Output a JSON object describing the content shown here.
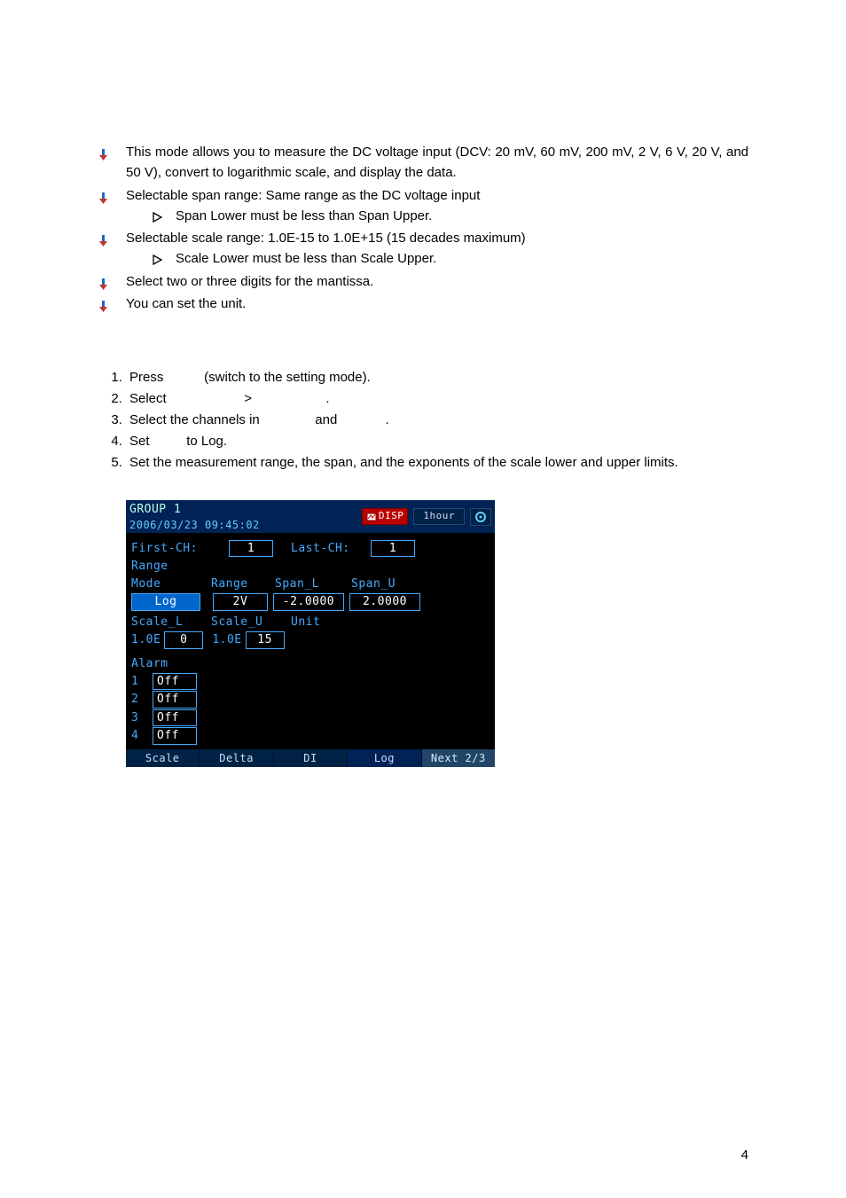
{
  "bullets": [
    {
      "text": "This mode allows you to measure the DC voltage input (DCV: 20 mV, 60 mV, 200 mV, 2 V, 6 V, 20 V, and 50 V), convert to logarithmic scale, and display the data."
    },
    {
      "text": "Selectable span range:  Same range as the DC voltage input",
      "sub": [
        "Span Lower must be less than Span Upper."
      ]
    },
    {
      "text": "Selectable scale range:  1.0E-15 to 1.0E+15 (15 decades maximum)",
      "sub": [
        "Scale Lower must be less than Scale Upper."
      ]
    },
    {
      "text": "Select two or three digits for the mantissa."
    },
    {
      "text": "You can set the unit."
    }
  ],
  "steps": [
    "Press           (switch to the setting mode).",
    "Select                     >                    .",
    "Select the channels in               and             .",
    "Set          to Log.",
    "Set the measurement range, the span, and the exponents of the scale lower and upper limits."
  ],
  "screenshot": {
    "header": {
      "group": "GROUP 1",
      "timestamp": "2006/03/23 09:45:02",
      "disp": "DISP",
      "period": "1hour"
    },
    "first_ch_label": "First-CH:",
    "first_ch_value": "1",
    "last_ch_label": "Last-CH:",
    "last_ch_value": "1",
    "range_heading": "Range",
    "mode_label": "Mode",
    "range_col": "Range",
    "spanl_col": "Span_L",
    "spanu_col": "Span_U",
    "mode_value": "Log",
    "range_value": "2V",
    "spanl_value": "-2.0000",
    "spanu_value": "2.0000",
    "scalel_label": "Scale_L",
    "scaleu_label": "Scale_U",
    "unit_label": "Unit",
    "scalel_prefix": "1.0E",
    "scalel_exp": "0",
    "scaleu_prefix": "1.0E",
    "scaleu_exp": "15",
    "alarm_heading": "Alarm",
    "alarms": [
      {
        "n": "1",
        "v": "Off"
      },
      {
        "n": "2",
        "v": "Off"
      },
      {
        "n": "3",
        "v": "Off"
      },
      {
        "n": "4",
        "v": "Off"
      }
    ],
    "tabs": [
      "Scale",
      "Delta",
      "DI",
      "Log",
      "Next 2/3"
    ]
  },
  "page_number": "4",
  "chart_data": {
    "type": "table",
    "title": "Range configuration (Log mode) screenshot values",
    "rows": [
      {
        "field": "First-CH",
        "value": 1
      },
      {
        "field": "Last-CH",
        "value": 1
      },
      {
        "field": "Mode",
        "value": "Log"
      },
      {
        "field": "Range",
        "value": "2V"
      },
      {
        "field": "Span_L",
        "value": -2.0
      },
      {
        "field": "Span_U",
        "value": 2.0
      },
      {
        "field": "Scale_L",
        "value": "1.0E0"
      },
      {
        "field": "Scale_U",
        "value": "1.0E15"
      },
      {
        "field": "Alarm 1",
        "value": "Off"
      },
      {
        "field": "Alarm 2",
        "value": "Off"
      },
      {
        "field": "Alarm 3",
        "value": "Off"
      },
      {
        "field": "Alarm 4",
        "value": "Off"
      }
    ]
  }
}
